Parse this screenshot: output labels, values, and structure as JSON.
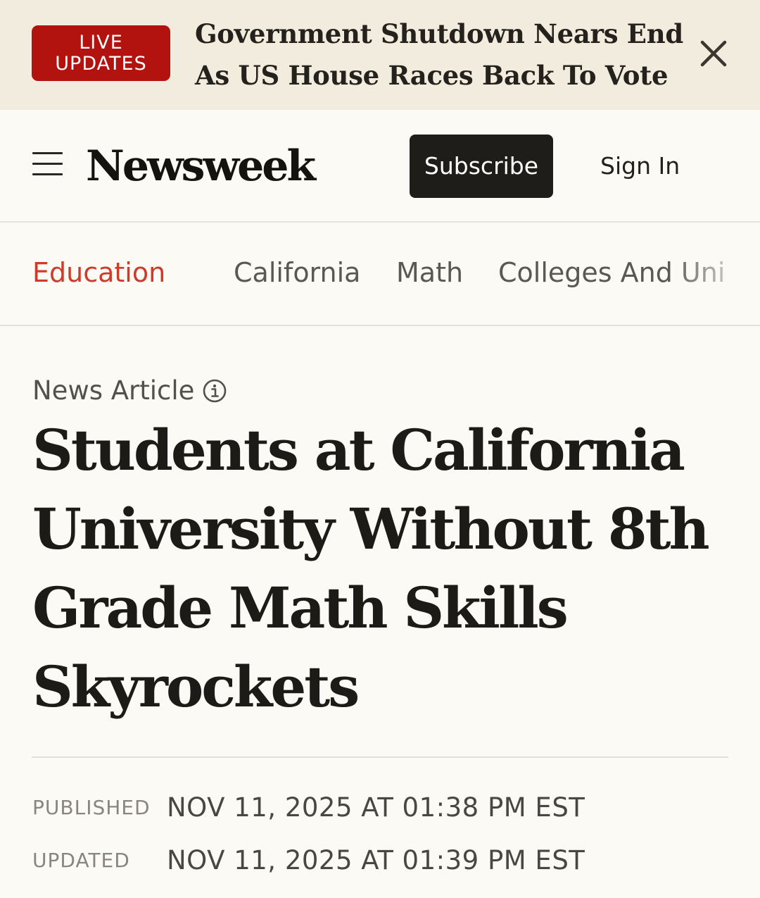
{
  "live_banner": {
    "badge_line1": "LIVE",
    "badge_line2": "UPDATES",
    "badge_color": "#b3130f",
    "headline_line1": "Government Shutdown Nears End",
    "headline_line2": "As US House Races Back To Vote",
    "close_icon": "close-icon"
  },
  "header": {
    "menu_icon": "hamburger-menu-icon",
    "logo": "Newsweek",
    "subscribe_label": "Subscribe",
    "signin_label": "Sign In"
  },
  "topics": {
    "active_color": "#cf3b2b",
    "items": [
      {
        "label": "Education",
        "active": true
      },
      {
        "label": "California",
        "active": false
      },
      {
        "label": "Math",
        "active": false
      },
      {
        "label": "Colleges And Uni",
        "active": false
      }
    ]
  },
  "article": {
    "type_label": "News Article",
    "info_icon": "info-icon",
    "headline_lines": [
      "Students at California",
      "University Without 8th",
      "Grade Math Skills",
      "Skyrockets"
    ],
    "published_label": "PUBLISHED",
    "published_value": "NOV 11, 2025 AT 01:38 PM EST",
    "updated_label": "UPDATED",
    "updated_value": "NOV 11, 2025 AT 01:39 PM EST"
  }
}
